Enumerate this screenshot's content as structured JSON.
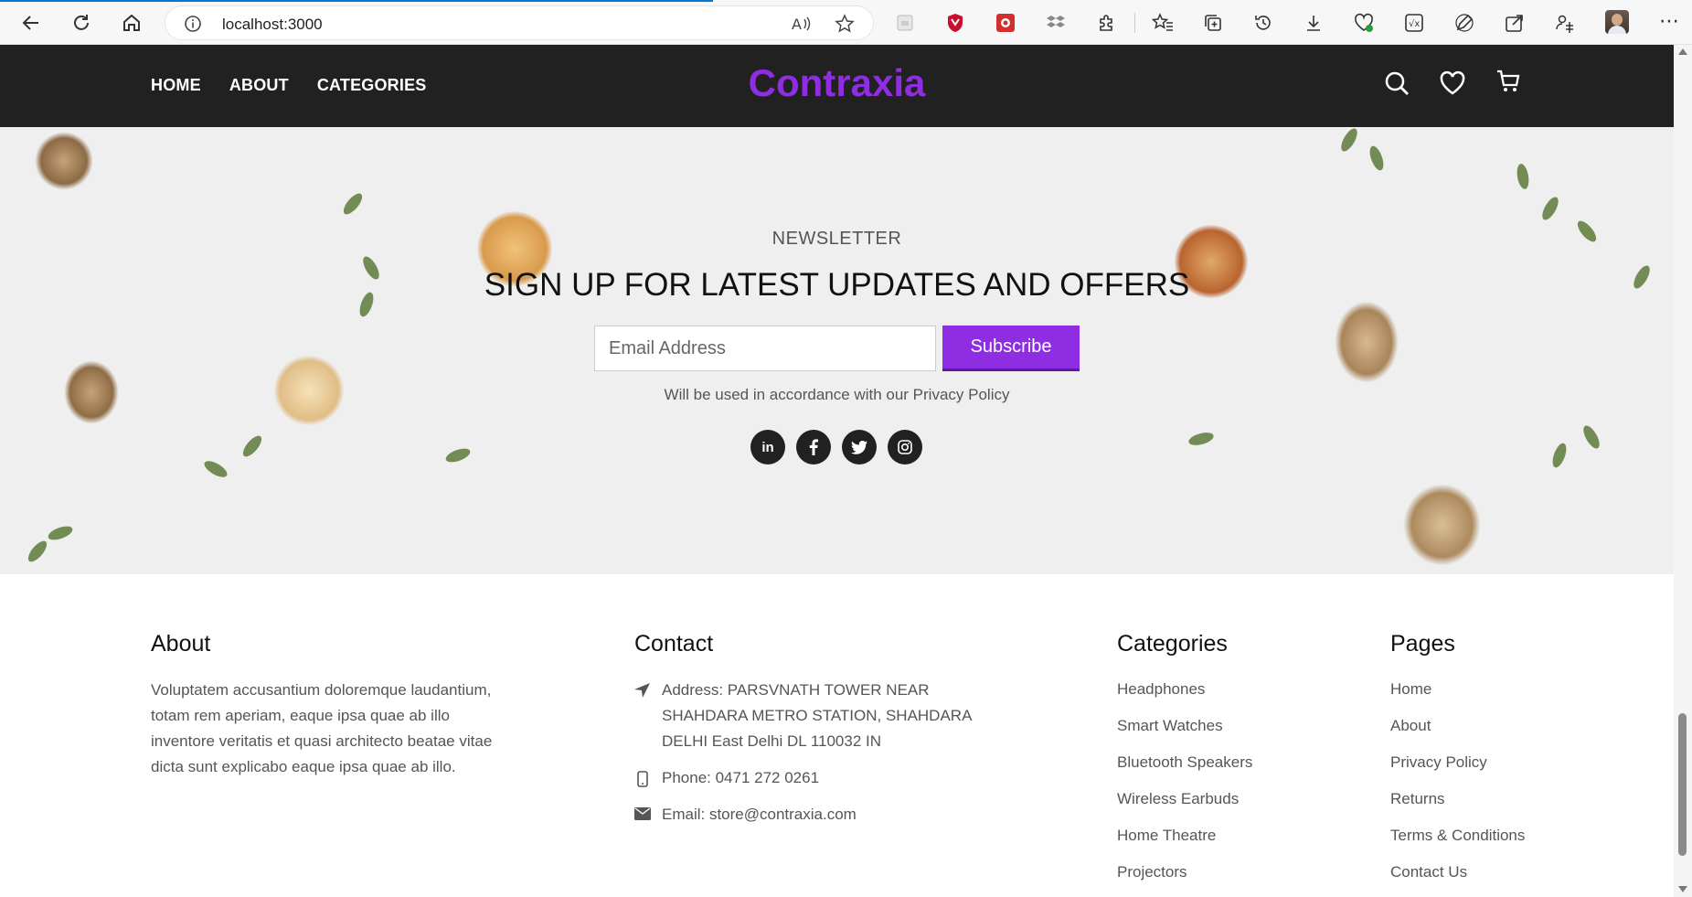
{
  "browser": {
    "url": "localhost:3000"
  },
  "header": {
    "nav": [
      "HOME",
      "ABOUT",
      "CATEGORIES"
    ],
    "brand": "Contraxia",
    "brand_color": "#8e2de2"
  },
  "newsletter": {
    "eyebrow": "NEWSLETTER",
    "title": "SIGN UP FOR LATEST UPDATES AND OFFERS",
    "email_placeholder": "Email Address",
    "subscribe_label": "Subscribe",
    "note": "Will be used in accordance with our Privacy Policy",
    "socials": [
      "linkedin-icon",
      "facebook-icon",
      "twitter-icon",
      "instagram-icon"
    ]
  },
  "footer": {
    "about": {
      "heading": "About",
      "text": "Voluptatem accusantium doloremque laudantium, totam rem aperiam, eaque ipsa quae ab illo inventore veritatis et quasi architecto beatae vitae dicta sunt explicabo eaque ipsa quae ab illo."
    },
    "contact": {
      "heading": "Contact",
      "address": "Address: PARSVNATH TOWER NEAR SHAHDARA METRO STATION, SHAHDARA DELHI East Delhi DL 110032 IN",
      "phone": "Phone: 0471 272 0261",
      "email": "Email: store@contraxia.com"
    },
    "categories": {
      "heading": "Categories",
      "items": [
        "Headphones",
        "Smart Watches",
        "Bluetooth Speakers",
        "Wireless Earbuds",
        "Home Theatre",
        "Projectors"
      ]
    },
    "pages": {
      "heading": "Pages",
      "items": [
        "Home",
        "About",
        "Privacy Policy",
        "Returns",
        "Terms & Conditions",
        "Contact Us"
      ]
    }
  }
}
